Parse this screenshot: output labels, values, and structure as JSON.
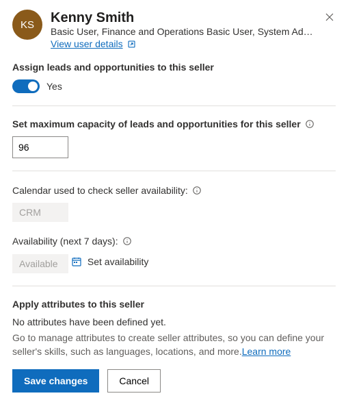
{
  "user": {
    "initials": "KS",
    "name": "Kenny Smith",
    "roles": "Basic User, Finance and Operations Basic User, System Administr…",
    "view_link": "View user details"
  },
  "assign": {
    "label": "Assign leads and opportunities to this seller",
    "toggle_value": "Yes"
  },
  "capacity": {
    "label": "Set maximum capacity of leads and opportunities for this seller",
    "value": "96"
  },
  "calendar": {
    "label": "Calendar used to check seller availability:",
    "value": "CRM"
  },
  "availability": {
    "label": "Availability (next 7 days):",
    "value": "Available",
    "set_label": "Set availability"
  },
  "attributes": {
    "label": "Apply attributes to this seller",
    "empty": "No attributes have been defined yet.",
    "help": "Go to manage attributes to create seller attributes, so you can define your seller's skills, such as languages, locations, and more.",
    "learn_more": "Learn more"
  },
  "footer": {
    "save": "Save changes",
    "cancel": "Cancel"
  }
}
